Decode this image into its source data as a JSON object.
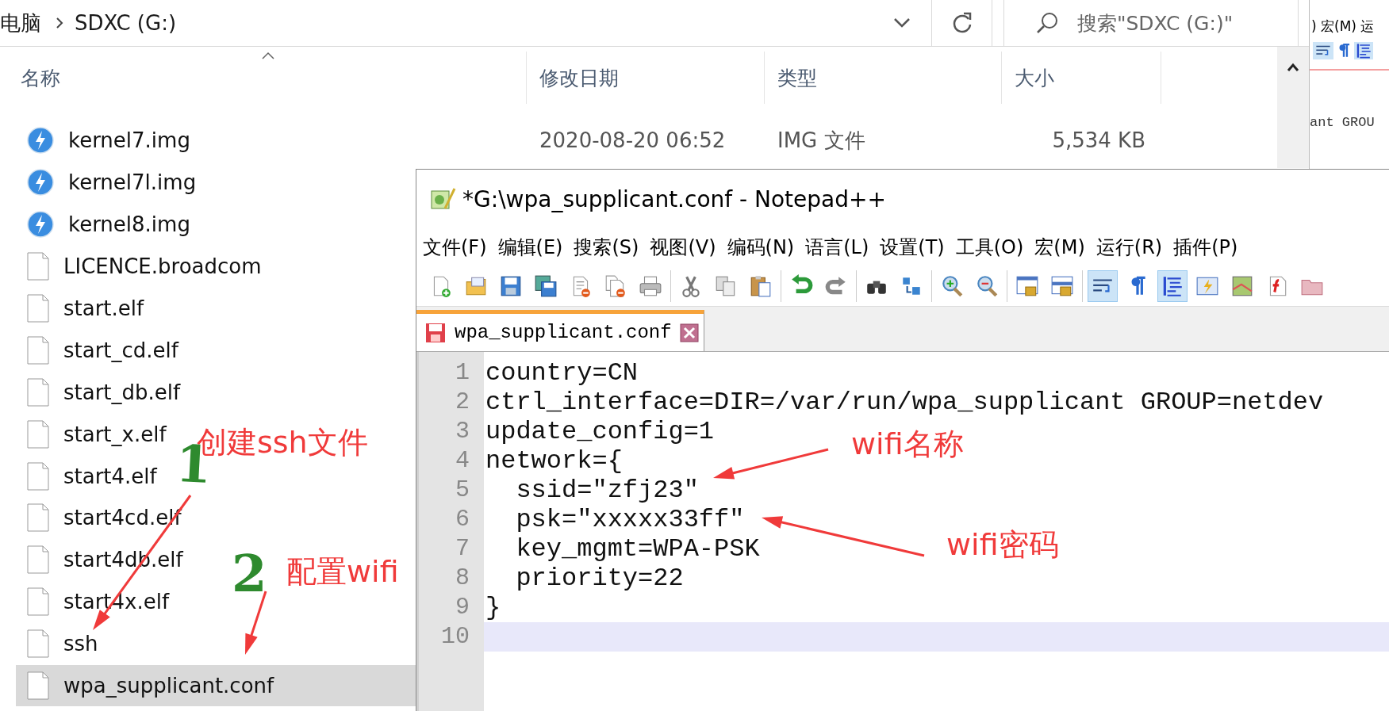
{
  "explorer": {
    "breadcrumb": [
      "电脑",
      "SDXC (G:)"
    ],
    "search": {
      "placeholder": "搜索\"SDXC (G:)\""
    },
    "columns": [
      "名称",
      "修改日期",
      "类型",
      "大小"
    ],
    "files": [
      {
        "name": "kernel7.img",
        "kind": "img",
        "date": "2020-08-20 06:52",
        "type": "IMG 文件",
        "size": "5,534 KB",
        "selected": false
      },
      {
        "name": "kernel7l.img",
        "kind": "img",
        "selected": false
      },
      {
        "name": "kernel8.img",
        "kind": "img",
        "selected": false
      },
      {
        "name": "LICENCE.broadcom",
        "kind": "file",
        "selected": false
      },
      {
        "name": "start.elf",
        "kind": "file",
        "selected": false
      },
      {
        "name": "start_cd.elf",
        "kind": "file",
        "selected": false
      },
      {
        "name": "start_db.elf",
        "kind": "file",
        "selected": false
      },
      {
        "name": "start_x.elf",
        "kind": "file",
        "selected": false
      },
      {
        "name": "start4.elf",
        "kind": "file",
        "selected": false
      },
      {
        "name": "start4cd.elf",
        "kind": "file",
        "selected": false
      },
      {
        "name": "start4db.elf",
        "kind": "file",
        "selected": false
      },
      {
        "name": "start4x.elf",
        "kind": "file",
        "selected": false
      },
      {
        "name": "ssh",
        "kind": "file",
        "selected": false
      },
      {
        "name": "wpa_supplicant.conf",
        "kind": "file",
        "selected": true
      }
    ]
  },
  "back_window": {
    "menu_fragment": ") 宏(M) 运",
    "code_fragment": "ant GROU"
  },
  "notepad": {
    "title": "*G:\\wpa_supplicant.conf - Notepad++",
    "menu": [
      "文件(F)",
      "编辑(E)",
      "搜索(S)",
      "视图(V)",
      "编码(N)",
      "语言(L)",
      "设置(T)",
      "工具(O)",
      "宏(M)",
      "运行(R)",
      "插件(P)"
    ],
    "toolbar_groups": [
      {
        "buttons": [
          {
            "kind": "new",
            "pressed": false
          },
          {
            "kind": "open",
            "pressed": false
          },
          {
            "kind": "save",
            "pressed": false
          },
          {
            "kind": "save-all",
            "pressed": false
          },
          {
            "kind": "close",
            "pressed": false
          },
          {
            "kind": "close-all",
            "pressed": false
          },
          {
            "kind": "print",
            "pressed": false
          }
        ]
      },
      {
        "buttons": [
          {
            "kind": "cut",
            "pressed": false
          },
          {
            "kind": "copy",
            "pressed": false
          },
          {
            "kind": "paste",
            "pressed": false
          }
        ]
      },
      {
        "buttons": [
          {
            "kind": "undo",
            "pressed": false
          },
          {
            "kind": "redo",
            "pressed": false
          }
        ]
      },
      {
        "buttons": [
          {
            "kind": "find",
            "pressed": false
          },
          {
            "kind": "replace",
            "pressed": false
          }
        ]
      },
      {
        "buttons": [
          {
            "kind": "zoom-in",
            "pressed": false
          },
          {
            "kind": "zoom-out",
            "pressed": false
          }
        ]
      },
      {
        "buttons": [
          {
            "kind": "sync-v",
            "pressed": false
          },
          {
            "kind": "sync-h",
            "pressed": false
          }
        ]
      },
      {
        "buttons": [
          {
            "kind": "wrap",
            "pressed": true
          },
          {
            "kind": "pilcrow",
            "pressed": false
          },
          {
            "kind": "indent",
            "pressed": true
          },
          {
            "kind": "udl",
            "pressed": false
          },
          {
            "kind": "doc-map",
            "pressed": false
          },
          {
            "kind": "func",
            "pressed": false
          },
          {
            "kind": "folder",
            "pressed": false
          }
        ]
      }
    ],
    "tab": {
      "label": "wpa_supplicant.conf",
      "modified": true
    },
    "lines": [
      {
        "number": "1",
        "text": "country=CN",
        "current": false
      },
      {
        "number": "2",
        "text": "ctrl_interface=DIR=/var/run/wpa_supplicant GROUP=netdev",
        "current": false
      },
      {
        "number": "3",
        "text": "update_config=1",
        "current": false
      },
      {
        "number": "4",
        "text": "network={",
        "current": false
      },
      {
        "number": "5",
        "text": "  ssid=\"zfj23\"",
        "current": false
      },
      {
        "number": "6",
        "text": "  psk=\"xxxxx33ff\"",
        "current": false
      },
      {
        "number": "7",
        "text": "  key_mgmt=WPA-PSK",
        "current": false
      },
      {
        "number": "8",
        "text": "  priority=22",
        "current": false
      },
      {
        "number": "9",
        "text": "}",
        "current": false
      },
      {
        "number": "10",
        "current": true
      }
    ]
  },
  "annotations": [
    {
      "kind": "numeral",
      "text": "1"
    },
    {
      "kind": "note",
      "text": "创建ssh文件"
    },
    {
      "kind": "numeral",
      "text": "2"
    },
    {
      "kind": "note",
      "text": "配置wifi"
    },
    {
      "kind": "note",
      "text": "wifi名称"
    },
    {
      "kind": "note",
      "text": "wifi密码"
    }
  ]
}
